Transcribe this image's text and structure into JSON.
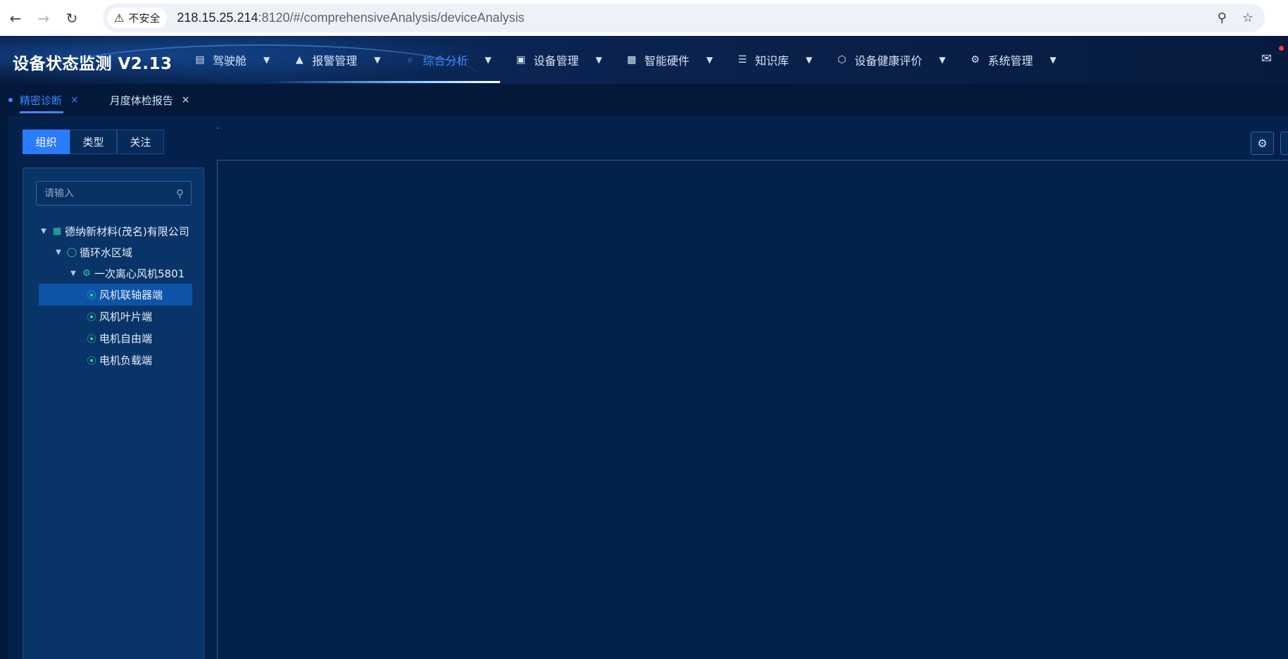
{
  "browser": {
    "security_label": "不安全",
    "url_host": "218.15.25.214",
    "url_rest": ":8120/#/comprehensiveAnalysis/deviceAnalysis"
  },
  "app": {
    "title": "设备状态监测 V2.13",
    "menu": [
      {
        "label": "驾驶舱",
        "icon": "chart-icon"
      },
      {
        "label": "报警管理",
        "icon": "alarm-icon"
      },
      {
        "label": "综合分析",
        "icon": "analysis-icon",
        "active": true
      },
      {
        "label": "设备管理",
        "icon": "monitor-icon"
      },
      {
        "label": "智能硬件",
        "icon": "chip-icon"
      },
      {
        "label": "知识库",
        "icon": "book-icon"
      },
      {
        "label": "设备健康评价",
        "icon": "health-icon"
      },
      {
        "label": "系统管理",
        "icon": "settings-icon"
      }
    ],
    "accent_color": "#3d8bff"
  },
  "tabs": [
    {
      "label": "精密诊断",
      "active": true
    },
    {
      "label": "月度体检报告",
      "active": false
    }
  ],
  "segment": [
    "组织",
    "类型",
    "关注"
  ],
  "search": {
    "placeholder": "请输入"
  },
  "tree": {
    "company": "德纳新材料(茂名)有限公司",
    "area": "循环水区域",
    "device": "一次离心风机5801",
    "points": [
      "风机联轴器端",
      "风机叶片端",
      "电机自由端",
      "电机负载端"
    ]
  }
}
